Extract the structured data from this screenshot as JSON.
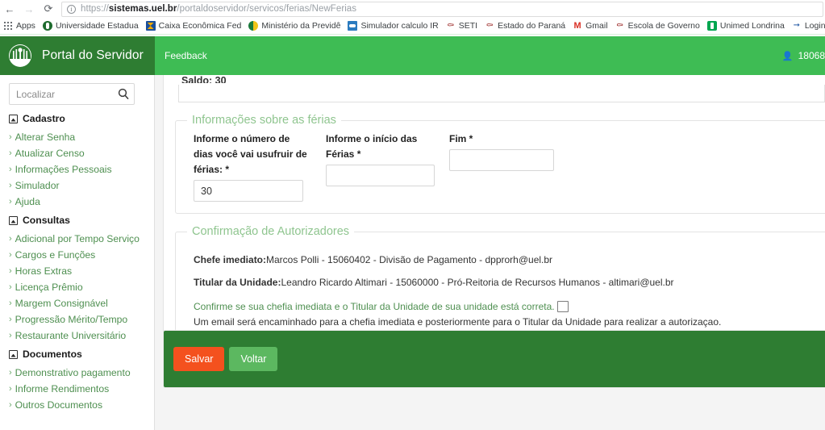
{
  "browser": {
    "back_icon": "←",
    "forward_icon": "→",
    "reload_icon": "⟳",
    "info_icon": "i",
    "url_scheme": "https://",
    "url_host": "sistemas.uel.br",
    "url_path": "/portaldoservidor/servicos/ferias/NewFerias",
    "bookmarks": [
      {
        "label": "Apps",
        "icon": "apps-grid-icon"
      },
      {
        "label": "Universidade Estadua",
        "icon": "uel-icon"
      },
      {
        "label": "Caixa Econômica Fed",
        "icon": "caixa-icon"
      },
      {
        "label": "Ministério da Previdê",
        "icon": "previdencia-icon"
      },
      {
        "label": "Simulador calculo IR",
        "icon": "simulador-icon"
      },
      {
        "label": "SETI",
        "icon": "brasao-icon"
      },
      {
        "label": "Estado do Paraná",
        "icon": "brasao-icon"
      },
      {
        "label": "Gmail",
        "icon": "gmail-icon"
      },
      {
        "label": "Escola de Governo",
        "icon": "brasao-icon"
      },
      {
        "label": "Unimed Londrina",
        "icon": "unimed-icon"
      },
      {
        "label": "Login - Carrefour",
        "icon": "carrefour-icon"
      }
    ]
  },
  "header": {
    "brand_title": "Portal do Servidor",
    "feedback_label": "Feedback",
    "user_icon": "user-icon",
    "user_id": "18068"
  },
  "sidebar": {
    "search_placeholder": "Localizar",
    "search_value": "",
    "search_icon": "search-icon",
    "groups": [
      {
        "title": "Cadastro",
        "items": [
          "Alterar Senha",
          "Atualizar Censo",
          "Informações Pessoais",
          "Simulador",
          "Ajuda"
        ]
      },
      {
        "title": "Consultas",
        "items": [
          "Adicional por Tempo Serviço",
          "Cargos e Funções",
          "Horas Extras",
          "Licença Prêmio",
          "Margem Consignável",
          "Progressão Mérito/Tempo",
          "Restaurante Universitário"
        ]
      },
      {
        "title": "Documentos",
        "items": [
          "Demonstrativo pagamento",
          "Informe Rendimentos",
          "Outros Documentos"
        ]
      }
    ]
  },
  "main": {
    "saldo_text": "Saldo: 30",
    "ferias_fieldset": {
      "legend": "Informações sobre as férias",
      "fields": [
        {
          "label": "Informe o número de dias você vai usufruir de férias: *",
          "value": "30",
          "placeholder": ""
        },
        {
          "label": "Informe o início das Férias *",
          "value": "",
          "placeholder": ""
        },
        {
          "label": "Fim *",
          "value": "",
          "placeholder": ""
        }
      ]
    },
    "auth_fieldset": {
      "legend": "Confirmação de Autorizadores",
      "chefe_label": "Chefe imediato:",
      "chefe_value": "Marcos Polli - 15060402 - Divisão de Pagamento - dpprorh@uel.br",
      "titular_label": "Titular da Unidade:",
      "titular_value": "Leandro Ricardo Altimari - 15060000 - Pró-Reitoria de Recursos Humanos - altimari@uel.br",
      "confirm_text": "Confirme se sua chefia imediata e o Titular da Unidade de sua unidade está correta.",
      "confirm_checked": false,
      "note_text": "Um email será encaminhado para a chefia imediata e posteriormente para o Titular da Unidade para realizar a autorizaçao."
    },
    "footer": {
      "save_label": "Salvar",
      "back_label": "Voltar"
    }
  },
  "colors": {
    "brand_dark_green": "#2e7d32",
    "brand_green": "#3ebc54",
    "link_green": "#4e8f50",
    "legend_green": "#8fc58f",
    "save_orange": "#f4511e",
    "back_green": "#5cb860"
  }
}
